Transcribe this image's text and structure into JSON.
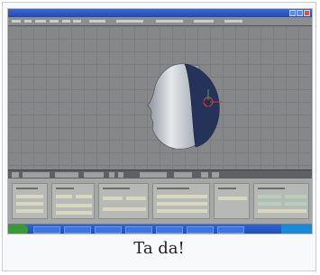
{
  "caption": "Ta da!",
  "colors": {
    "viewport_bg": "#858789",
    "object_light": "#d8dde3",
    "object_dark": "#25325a",
    "taskbar_blue": "#2148b0",
    "start_green": "#3a9a3a",
    "buttons_panel": "#a4a7a6"
  },
  "icons": {
    "close": "close-icon",
    "cursor": "3d-cursor-icon"
  }
}
